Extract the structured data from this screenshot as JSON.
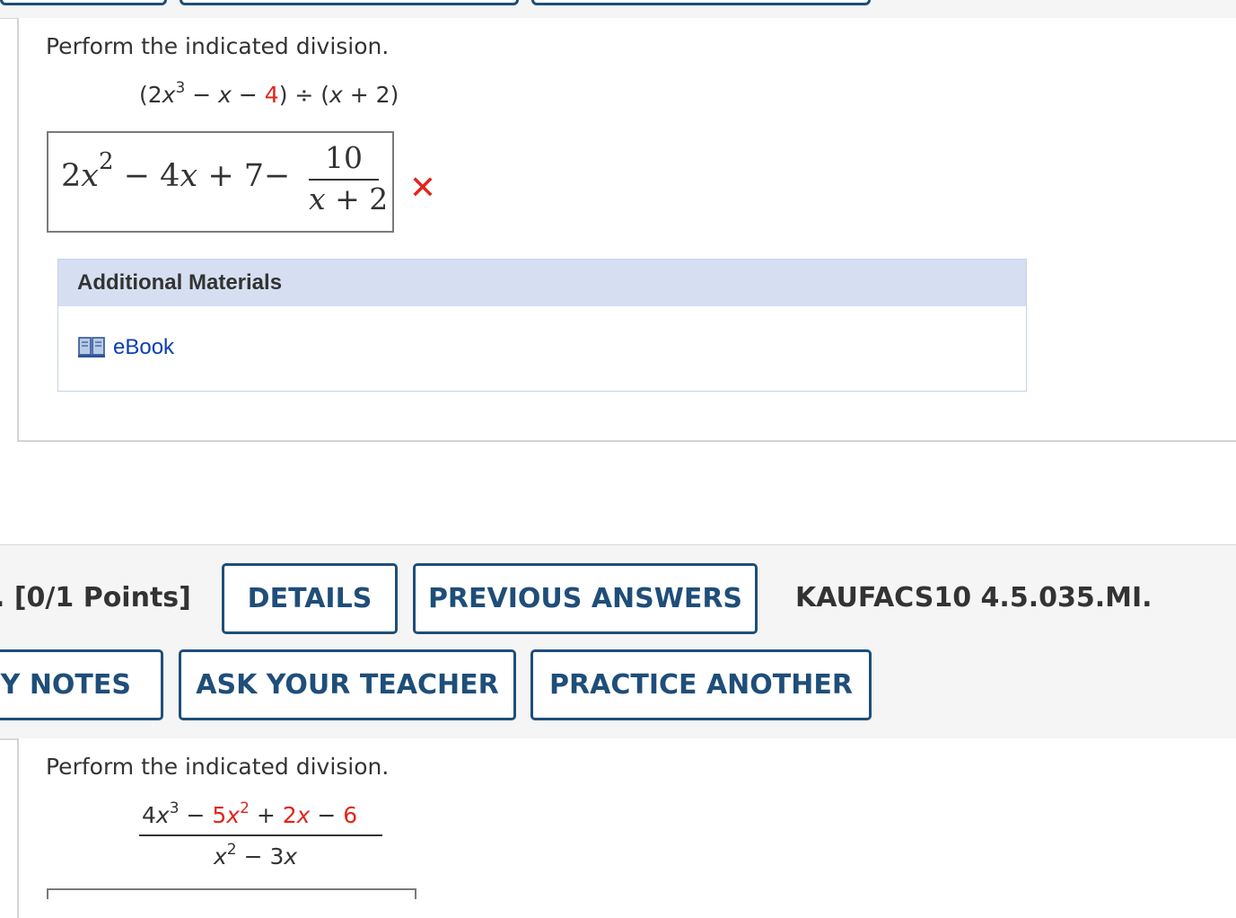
{
  "q1": {
    "prompt": "Perform the indicated division.",
    "expression": {
      "open": "(2",
      "var1": "x",
      "exp1": "3",
      "minus1": " − ",
      "var2": "x",
      "minus2": " − ",
      "const": "4",
      "close": ") ÷ (",
      "var3": "x",
      "tail": " + 2)"
    },
    "answer": {
      "poly": "2x² − 4x + 7",
      "coef1": "2",
      "var": "x",
      "exp": "2",
      "mid": " − 4",
      "var2": "x",
      "tail": " + 7",
      "minus": "−",
      "numerator": "10",
      "denominator": "x + 2"
    },
    "status": "incorrect",
    "x_mark": "✕",
    "additional_materials": {
      "title": "Additional Materials",
      "ebook": "eBook"
    }
  },
  "q2_header": {
    "points": ". [0/1 Points]",
    "details": "DETAILS",
    "previous_answers": "PREVIOUS ANSWERS",
    "code": "KAUFACS10 4.5.035.MI.",
    "my_notes": "MY NOTES",
    "ask_teacher": "ASK YOUR TEACHER",
    "practice_another": "PRACTICE ANOTHER"
  },
  "q2": {
    "prompt": "Perform the indicated division.",
    "numerator": {
      "t1": "4",
      "v1": "x",
      "e1": "3",
      "op1": " − ",
      "t2": "5",
      "v2": "x",
      "e2": "2",
      "op2": " + ",
      "t3": "2",
      "v3": "x",
      "op3": " − ",
      "t4": "6"
    },
    "denominator": {
      "v1": "x",
      "e1": "2",
      "op": " − 3",
      "v2": "x"
    }
  },
  "colors": {
    "button_border": "#1f4e79",
    "error_red": "#e0261b",
    "materials_header": "#d6dff2",
    "link_blue": "#0b3fb3"
  }
}
